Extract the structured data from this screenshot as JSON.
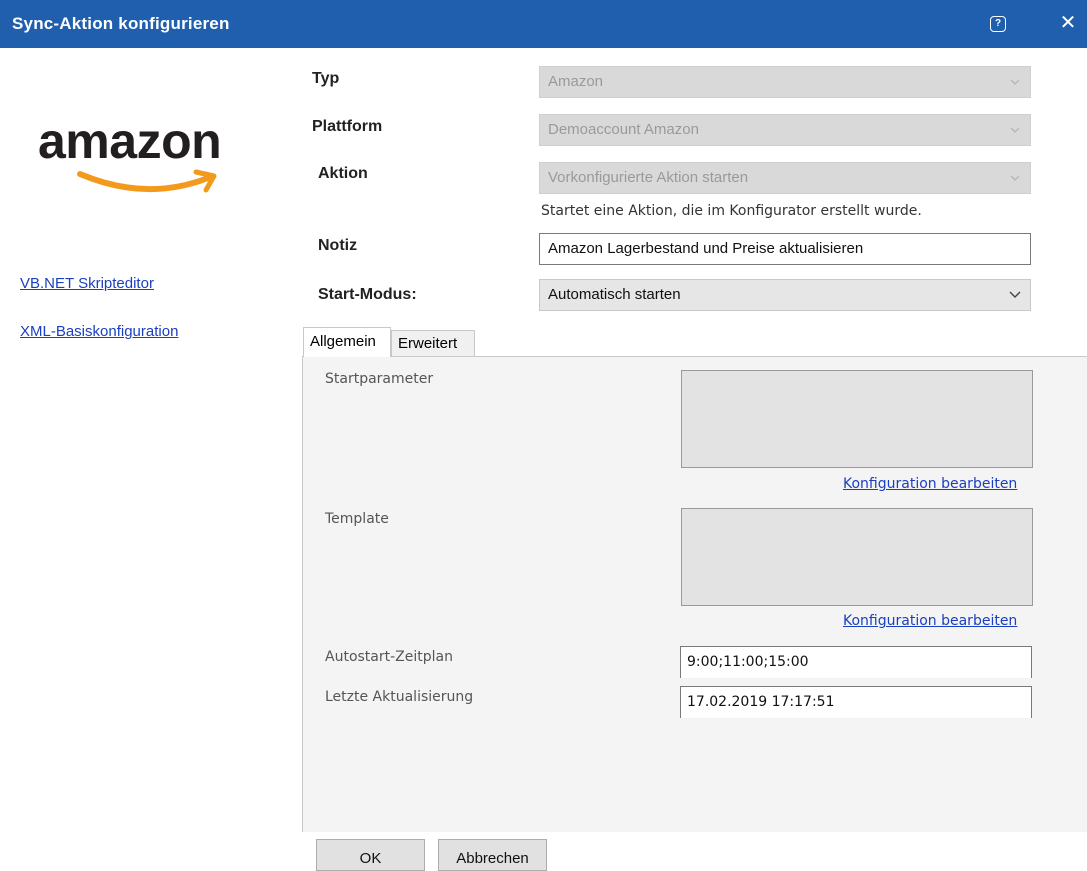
{
  "window": {
    "title": "Sync-Aktion konfigurieren",
    "help_glyph": "?",
    "close_glyph": "✕"
  },
  "logo": {
    "text": "amazon"
  },
  "sidebar": {
    "links": [
      "VB.NET Skripteditor",
      "XML-Basiskonfiguration"
    ]
  },
  "form": {
    "typ": {
      "label": "Typ",
      "value": "Amazon"
    },
    "plattform": {
      "label": "Plattform",
      "value": "Demoaccount Amazon"
    },
    "aktion": {
      "label": "Aktion",
      "value": "Vorkonfigurierte Aktion starten",
      "hint": "Startet eine Aktion, die im Konfigurator erstellt wurde."
    },
    "notiz": {
      "label": "Notiz",
      "value": "Amazon Lagerbestand und Preise aktualisieren"
    },
    "startmodus": {
      "label": "Start-Modus:",
      "value": "Automatisch starten"
    }
  },
  "tabs": [
    {
      "label": "Allgemein",
      "active": true
    },
    {
      "label": "Erweitert",
      "active": false
    }
  ],
  "panel": {
    "startparameter": {
      "label": "Startparameter",
      "value": "",
      "link": "Konfiguration bearbeiten"
    },
    "template": {
      "label": "Template",
      "value": "",
      "link": "Konfiguration bearbeiten"
    },
    "autostart": {
      "label": "Autostart-Zeitplan",
      "value": "9:00;11:00;15:00"
    },
    "letzte": {
      "label": "Letzte Aktualisierung",
      "value": "17.02.2019 17:17:51"
    }
  },
  "buttons": {
    "ok": "OK",
    "cancel": "Abbrechen"
  },
  "colors": {
    "titlebar": "#1f5fae",
    "link": "#1a3fbf",
    "amazon_orange": "#f39a1d"
  }
}
